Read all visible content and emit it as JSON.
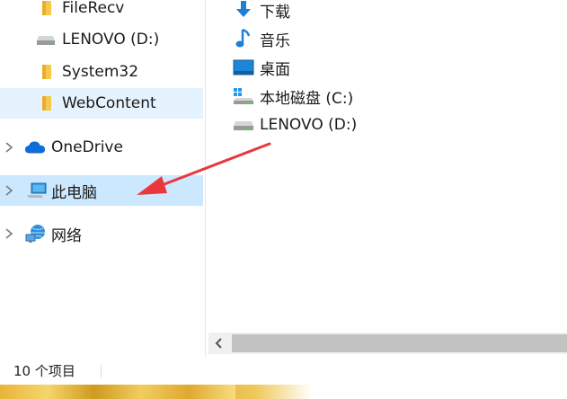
{
  "nav": {
    "items": [
      {
        "label": "FileRecv",
        "icon": "folder-icon"
      },
      {
        "label": "LENOVO (D:)",
        "icon": "drive-icon"
      },
      {
        "label": "System32",
        "icon": "folder-icon"
      },
      {
        "label": "WebContent",
        "icon": "folder-icon"
      },
      {
        "label": "OneDrive",
        "icon": "cloud-icon"
      },
      {
        "label": "此电脑",
        "icon": "computer-icon"
      },
      {
        "label": "网络",
        "icon": "network-icon"
      }
    ]
  },
  "content": {
    "items": [
      {
        "label": "下载",
        "icon": "download-arrow-icon"
      },
      {
        "label": "音乐",
        "icon": "music-note-icon"
      },
      {
        "label": "桌面",
        "icon": "desktop-icon"
      },
      {
        "label": "本地磁盘 (C:)",
        "icon": "windows-drive-icon"
      },
      {
        "label": "LENOVO (D:)",
        "icon": "drive-icon"
      }
    ]
  },
  "status": {
    "item_count": "10 个项目"
  },
  "colors": {
    "selected": "#cce8ff",
    "selected_soft": "#e5f3ff",
    "annotation_arrow": "#e8383d"
  }
}
